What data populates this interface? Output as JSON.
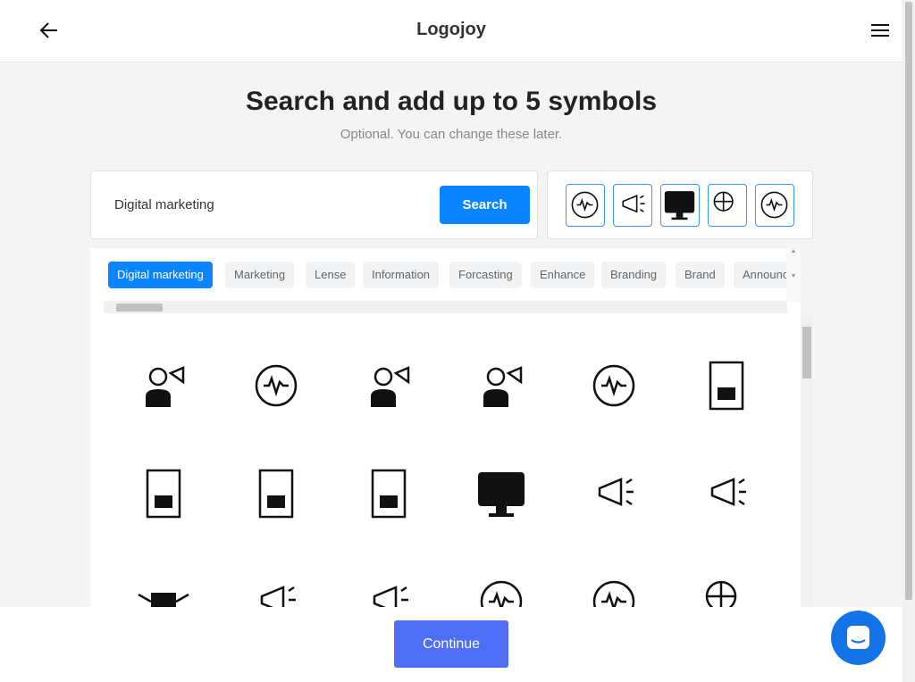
{
  "header": {
    "title": "Logojoy",
    "back_icon": "arrow-left-icon",
    "menu_icon": "hamburger-menu-icon"
  },
  "page": {
    "title": "Search and add up to 5 symbols",
    "subtitle": "Optional. You can change these later."
  },
  "search": {
    "value": "Digital marketing",
    "button": "Search"
  },
  "selected_symbols": [
    "megaphone-cycle-icon",
    "network-megaphone-icon",
    "monitor-chart-icon",
    "globe-web-icon",
    "lightbulb-cycle-icon"
  ],
  "tags": [
    {
      "label": "Digital marketing",
      "active": true
    },
    {
      "label": "Marketing"
    },
    {
      "label": "Lense"
    },
    {
      "label": "Information"
    },
    {
      "label": "Forcasting"
    },
    {
      "label": "Enhance"
    },
    {
      "label": "Branding"
    },
    {
      "label": "Brand"
    },
    {
      "label": "Announc"
    }
  ],
  "results": [
    "person-megaphone-icon",
    "gear-person-icon",
    "person-megaphone-icon",
    "megaphone-person-icon",
    "circle-wave-icon",
    "checklist-document-icon",
    "document-chart-icon",
    "document-checklist-icon",
    "document-chart-icon",
    "monitor-keyboard-icon",
    "devices-icon",
    "video-megaphone-icon",
    "winged-envelope-icon",
    "megaphone-icon",
    "podcast-icon",
    "dollar-cycle-icon",
    "target-arrow-icon",
    "globe-cursor-icon"
  ],
  "footer": {
    "continue": "Continue"
  },
  "colors": {
    "accent": "#0a84ff",
    "continue": "#4d6ef5",
    "chat": "#1473e6"
  }
}
